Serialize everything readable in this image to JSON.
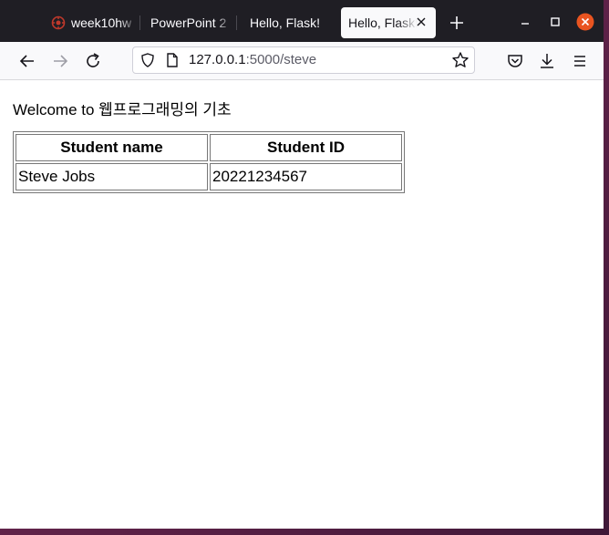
{
  "browser": {
    "tabs": [
      {
        "label": "week10hw",
        "active": false
      },
      {
        "label": "PowerPoint 2",
        "active": false
      },
      {
        "label": "Hello, Flask!",
        "active": false
      },
      {
        "label": "Hello, Flask!",
        "active": true
      }
    ],
    "new_tab_label": "+",
    "url": {
      "host": "127.0.0.1",
      "rest": ":5000/steve"
    },
    "icons": {
      "back": "arrow-left-icon",
      "forward": "arrow-right-icon",
      "reload": "reload-icon",
      "shield": "shield-icon",
      "page": "page-icon",
      "bookmark": "star-icon",
      "pocket": "pocket-icon",
      "downloads": "download-icon",
      "menu": "hamburger-menu-icon"
    },
    "colors": {
      "close_button": "#e95420",
      "tabbar": "#1f1e24"
    }
  },
  "page": {
    "welcome": "Welcome to 웹프로그래밍의 기초",
    "table": {
      "headers": [
        "Student name",
        "Student ID"
      ],
      "rows": [
        [
          "Steve Jobs",
          "20221234567"
        ]
      ]
    }
  }
}
